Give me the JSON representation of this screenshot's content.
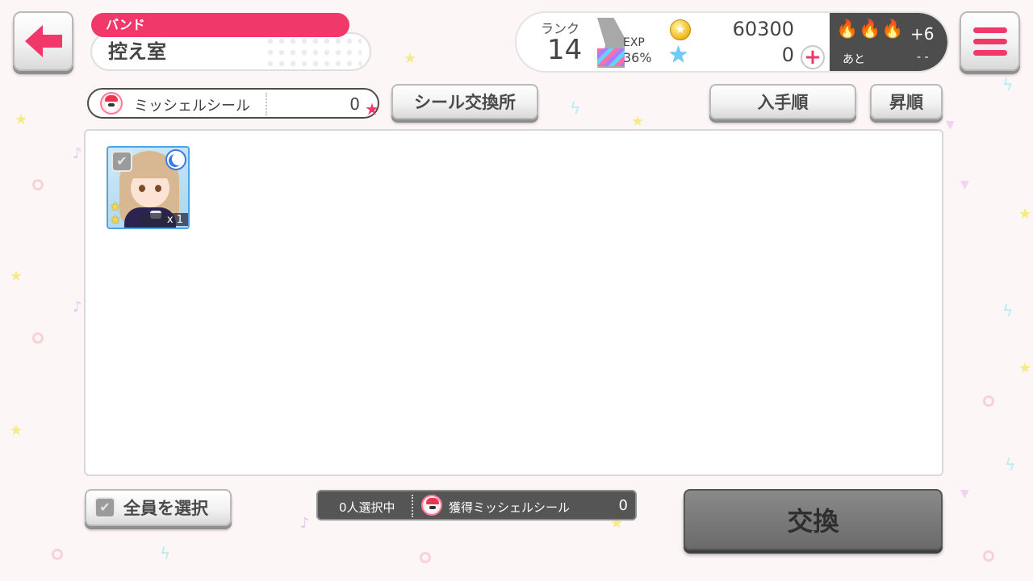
{
  "header": {
    "band_label": "バンド",
    "page_title": "控え室"
  },
  "status": {
    "rank_label": "ランク",
    "rank_value": "14",
    "exp_label": "EXP",
    "exp_percent": "36%",
    "exp_progress": 0.36,
    "coins": "60300",
    "star_gems": "0",
    "boost_count": "+6",
    "boost_remaining_label": "あと",
    "boost_remaining_value": "- -"
  },
  "seal": {
    "label": "ミッシェルシール",
    "value": "0"
  },
  "toolbar": {
    "seal_exchange": "シール交換所",
    "sort_by": "入手順",
    "sort_direction": "昇順"
  },
  "members": [
    {
      "quantity": "x 1",
      "rarity": 2,
      "attribute": "cool"
    }
  ],
  "footer": {
    "select_all": "全員を選択",
    "selected_count": "0人選択中",
    "obtained_seal_label": "獲得ミッシェルシール",
    "obtained_seal_value": "0",
    "exchange": "交換"
  },
  "colors": {
    "accent": "#f0386b",
    "attribute_cool": "#3e7be0"
  }
}
